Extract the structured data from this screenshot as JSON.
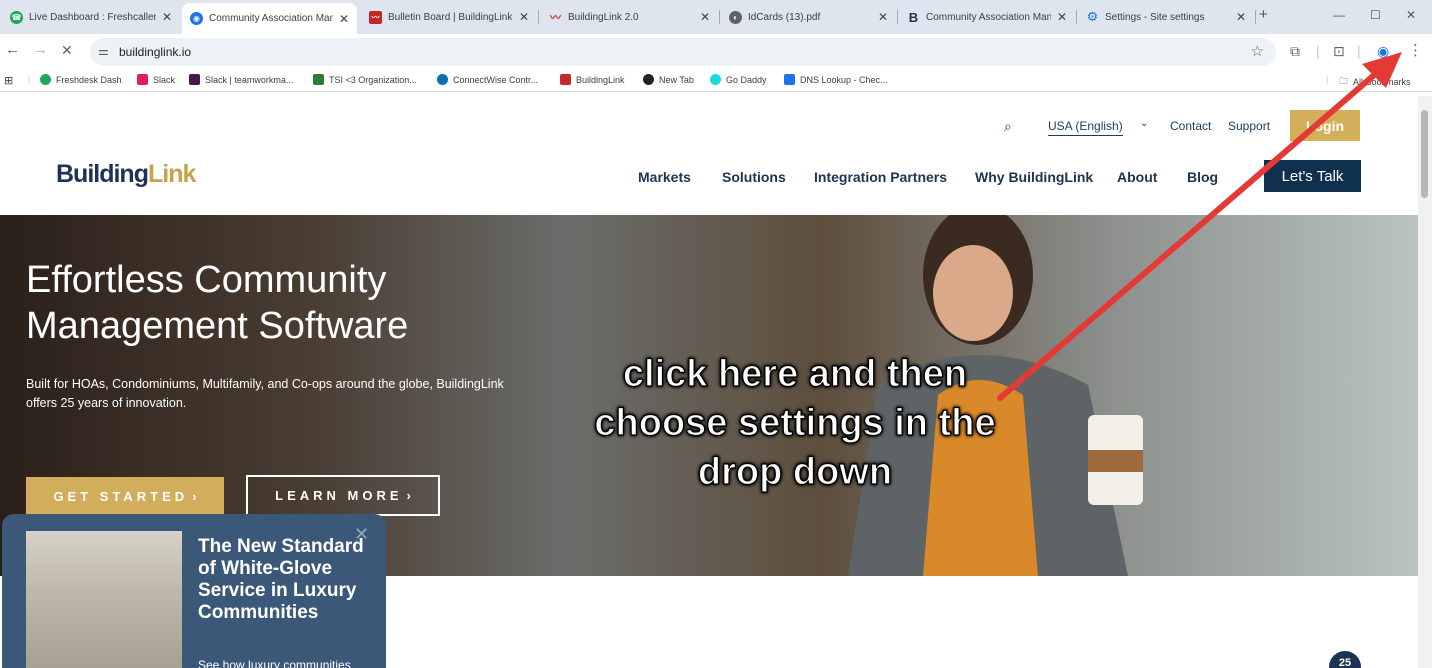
{
  "tabs": [
    {
      "title": "Live Dashboard : Freshcaller",
      "icon": "freshcaller-icon",
      "color": "#1fa855"
    },
    {
      "title": "Community Association Man",
      "icon": "buildinglink-icon",
      "color": "#1a73e8"
    },
    {
      "title": "Bulletin Board | BuildingLink",
      "icon": "buildinglink-red-icon",
      "color": "#c62828"
    },
    {
      "title": "BuildingLink 2.0",
      "icon": "buildinglink-2-icon",
      "color": "#d32f2f"
    },
    {
      "title": "IdCards (13).pdf",
      "icon": "globe-icon",
      "color": "#5f6368"
    },
    {
      "title": "Community Association Man",
      "icon": "b-logo-icon",
      "color": "#1e3353"
    },
    {
      "title": "Settings - Site settings",
      "icon": "settings-gear-icon",
      "color": "#1a73e8"
    }
  ],
  "toolbar": {
    "url": "buildinglink.io",
    "back_icon": "back-arrow-icon",
    "forward_icon": "forward-arrow-icon",
    "reload_icon": "stop-icon"
  },
  "bookmarks": [
    {
      "label": "Freshdesk Dash",
      "color": "#1fa855"
    },
    {
      "label": "Slack",
      "color": "#e01e5a"
    },
    {
      "label": "Slack | teamworkma...",
      "color": "#4a154b"
    },
    {
      "label": "TSI <3 Organization...",
      "color": "#2e7d32"
    },
    {
      "label": "ConnectWise Contr...",
      "color": "#0b6fb8"
    },
    {
      "label": "BuildingLink",
      "color": "#c62828"
    },
    {
      "label": "New Tab",
      "color": "#202124"
    },
    {
      "label": "Go Daddy",
      "color": "#1bdbdb"
    },
    {
      "label": "DNS Lookup - Chec...",
      "color": "#1a73e8"
    }
  ],
  "all_bookmarks": "All Bookmarks",
  "site": {
    "lang": "USA (English)",
    "contact": "Contact",
    "support": "Support",
    "login": "Login",
    "logo_part1": "Building",
    "logo_part2": "Link",
    "nav": [
      "Markets",
      "Solutions",
      "Integration Partners",
      "Why BuildingLink",
      "About",
      "Blog"
    ],
    "lets_talk": "Let's Talk"
  },
  "hero": {
    "title_line1": "Effortless Community",
    "title_line2": "Management Software",
    "subtitle": "Built for HOAs, Condominiums, Multifamily, and Co-ops around the globe, BuildingLink offers 25 years of innovation.",
    "cta_start": "GET STARTED",
    "cta_learn": "LEARN MORE"
  },
  "annotation": "click here and then choose settings in the drop down",
  "popup": {
    "title": "The New Standard of White-Glove Service in Luxury Communities",
    "subtitle": "See how luxury communities"
  },
  "badge": "25"
}
